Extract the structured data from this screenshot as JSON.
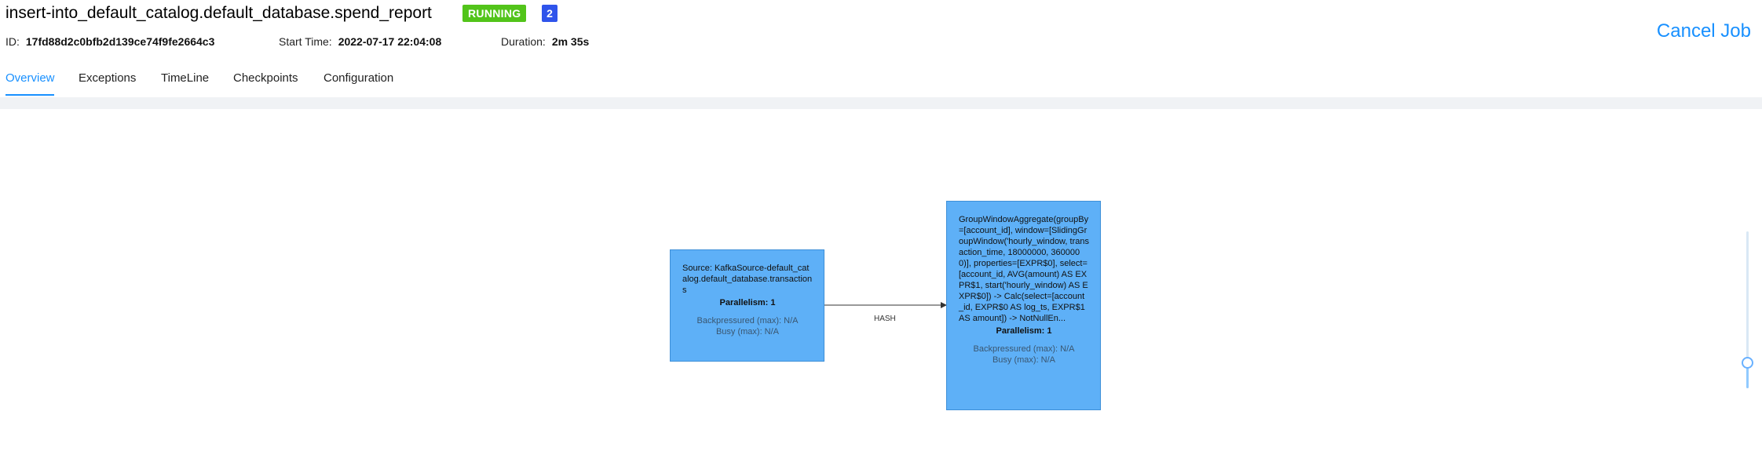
{
  "job": {
    "title": "insert-into_default_catalog.default_database.spend_report",
    "status": "RUNNING",
    "count_badge": "2",
    "id_label": "ID:",
    "id_value": "17fd88d2c0bfb2d139ce74f9fe2664c3",
    "start_label": "Start Time:",
    "start_value": "2022-07-17 22:04:08",
    "duration_label": "Duration:",
    "duration_value": "2m 35s",
    "cancel_label": "Cancel Job"
  },
  "tabs": [
    {
      "label": "Overview",
      "active": true
    },
    {
      "label": "Exceptions",
      "active": false
    },
    {
      "label": "TimeLine",
      "active": false
    },
    {
      "label": "Checkpoints",
      "active": false
    },
    {
      "label": "Configuration",
      "active": false
    }
  ],
  "graph": {
    "nodes": [
      {
        "description": "Source: KafkaSource-default_catalog.default_database.transactions",
        "parallelism": "Parallelism: 1",
        "backpressured": "Backpressured (max): N/A",
        "busy": "Busy (max): N/A"
      },
      {
        "description": "GroupWindowAggregate(groupBy=[account_id], window=[SlidingGroupWindow('hourly_window, transaction_time, 18000000, 3600000)], properties=[EXPR$0], select=[account_id, AVG(amount) AS EXPR$1, start('hourly_window) AS EXPR$0]) -> Calc(select=[account_id, EXPR$0 AS log_ts, EXPR$1 AS amount]) -> NotNullEn...",
        "parallelism": "Parallelism: 1",
        "backpressured": "Backpressured (max): N/A",
        "busy": "Busy (max): N/A"
      }
    ],
    "edge_label": "HASH"
  },
  "colors": {
    "accent": "#1890ff",
    "running": "#52c41a",
    "count_badge": "#2f54eb",
    "node_fill": "#5eb0f7"
  }
}
